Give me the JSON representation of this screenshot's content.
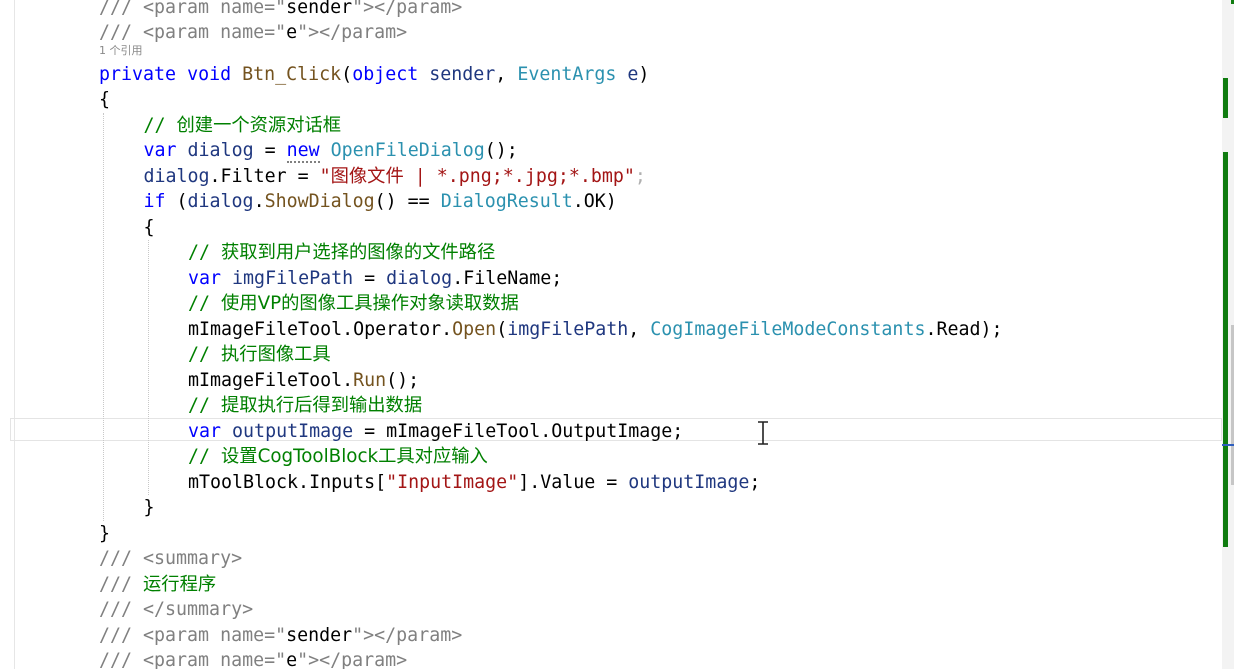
{
  "editor": {
    "lines": [
      {
        "indent": 0,
        "tokens": [
          {
            "t": "/// <param name=\"",
            "c": "doc"
          },
          {
            "t": "sender",
            "c": "plain"
          },
          {
            "t": "\"></param>",
            "c": "doc"
          }
        ]
      },
      {
        "indent": 0,
        "tokens": [
          {
            "t": "/// <param name=\"",
            "c": "doc"
          },
          {
            "t": "e",
            "c": "plain"
          },
          {
            "t": "\"></param>",
            "c": "doc"
          }
        ]
      },
      {
        "indent": 0,
        "tokens": [
          {
            "t": "private",
            "c": "kw"
          },
          {
            "t": " ",
            "c": "plain"
          },
          {
            "t": "void",
            "c": "kw"
          },
          {
            "t": " ",
            "c": "plain"
          },
          {
            "t": "Btn_Click",
            "c": "method"
          },
          {
            "t": "(",
            "c": "plain"
          },
          {
            "t": "object",
            "c": "kw"
          },
          {
            "t": " ",
            "c": "plain"
          },
          {
            "t": "sender",
            "c": "field"
          },
          {
            "t": ", ",
            "c": "plain"
          },
          {
            "t": "EventArgs",
            "c": "type"
          },
          {
            "t": " ",
            "c": "plain"
          },
          {
            "t": "e",
            "c": "field"
          },
          {
            "t": ")",
            "c": "plain"
          }
        ]
      },
      {
        "indent": 0,
        "tokens": [
          {
            "t": "{",
            "c": "plain"
          }
        ]
      },
      {
        "indent": 1,
        "tokens": [
          {
            "t": "// ",
            "c": "com"
          },
          {
            "t": "创建一个资源对话框",
            "c": "com",
            "cjk": true
          }
        ]
      },
      {
        "indent": 1,
        "tokens": [
          {
            "t": "var",
            "c": "kw"
          },
          {
            "t": " ",
            "c": "plain"
          },
          {
            "t": "dialog",
            "c": "field"
          },
          {
            "t": " = ",
            "c": "plain"
          },
          {
            "t": "new",
            "c": "new"
          },
          {
            "t": " ",
            "c": "plain"
          },
          {
            "t": "OpenFileDialog",
            "c": "type"
          },
          {
            "t": "();",
            "c": "plain"
          }
        ]
      },
      {
        "indent": 1,
        "tokens": [
          {
            "t": "dialog",
            "c": "field"
          },
          {
            "t": ".Filter = ",
            "c": "plain"
          },
          {
            "t": "\"",
            "c": "str"
          },
          {
            "t": "图像文件",
            "c": "str",
            "cjk": true
          },
          {
            "t": " | *.png;*.jpg;*.bmp\"",
            "c": "str"
          },
          {
            "t": ";",
            "c": "dim"
          }
        ]
      },
      {
        "indent": 1,
        "tokens": [
          {
            "t": "if",
            "c": "kw"
          },
          {
            "t": " (",
            "c": "plain"
          },
          {
            "t": "dialog",
            "c": "field"
          },
          {
            "t": ".",
            "c": "plain"
          },
          {
            "t": "ShowDialog",
            "c": "method"
          },
          {
            "t": "() == ",
            "c": "plain"
          },
          {
            "t": "DialogResult",
            "c": "type"
          },
          {
            "t": ".OK)",
            "c": "plain"
          }
        ]
      },
      {
        "indent": 1,
        "tokens": [
          {
            "t": "{",
            "c": "plain"
          }
        ]
      },
      {
        "indent": 2,
        "tokens": [
          {
            "t": "// ",
            "c": "com"
          },
          {
            "t": "获取到用户选择的图像的文件路径",
            "c": "com",
            "cjk": true
          }
        ]
      },
      {
        "indent": 2,
        "tokens": [
          {
            "t": "var",
            "c": "kw"
          },
          {
            "t": " ",
            "c": "plain"
          },
          {
            "t": "imgFilePath",
            "c": "field"
          },
          {
            "t": " = ",
            "c": "plain"
          },
          {
            "t": "dialog",
            "c": "field"
          },
          {
            "t": ".FileName;",
            "c": "plain"
          }
        ]
      },
      {
        "indent": 2,
        "tokens": [
          {
            "t": "// ",
            "c": "com"
          },
          {
            "t": "使用VP的图像工具操作对象读取数据",
            "c": "com",
            "cjk": true
          }
        ]
      },
      {
        "indent": 2,
        "tokens": [
          {
            "t": "mImageFileTool.Operator.",
            "c": "plain"
          },
          {
            "t": "Open",
            "c": "method"
          },
          {
            "t": "(",
            "c": "plain"
          },
          {
            "t": "imgFilePath",
            "c": "field"
          },
          {
            "t": ", ",
            "c": "plain"
          },
          {
            "t": "CogImageFileModeConstants",
            "c": "type"
          },
          {
            "t": ".Read);",
            "c": "plain"
          }
        ]
      },
      {
        "indent": 2,
        "tokens": [
          {
            "t": "// ",
            "c": "com"
          },
          {
            "t": "执行图像工具",
            "c": "com",
            "cjk": true
          }
        ]
      },
      {
        "indent": 2,
        "tokens": [
          {
            "t": "mImageFileTool.",
            "c": "plain"
          },
          {
            "t": "Run",
            "c": "method"
          },
          {
            "t": "();",
            "c": "plain"
          }
        ]
      },
      {
        "indent": 2,
        "tokens": [
          {
            "t": "// ",
            "c": "com"
          },
          {
            "t": "提取执行后得到输出数据",
            "c": "com",
            "cjk": true
          }
        ]
      },
      {
        "indent": 2,
        "tokens": [
          {
            "t": "var",
            "c": "kw"
          },
          {
            "t": " ",
            "c": "plain"
          },
          {
            "t": "outputImage",
            "c": "field"
          },
          {
            "t": " = mImageFileTool.OutputImage;",
            "c": "plain"
          }
        ]
      },
      {
        "indent": 2,
        "tokens": [
          {
            "t": "// ",
            "c": "com"
          },
          {
            "t": "设置CogToolBlock工具对应输入",
            "c": "com",
            "cjk": true
          }
        ]
      },
      {
        "indent": 2,
        "tokens": [
          {
            "t": "mToolBlock.Inputs[",
            "c": "plain"
          },
          {
            "t": "\"InputImage\"",
            "c": "str"
          },
          {
            "t": "].Value = ",
            "c": "plain"
          },
          {
            "t": "outputImage",
            "c": "field"
          },
          {
            "t": ";",
            "c": "plain"
          }
        ]
      },
      {
        "indent": 1,
        "tokens": [
          {
            "t": "}",
            "c": "plain"
          }
        ]
      },
      {
        "indent": 0,
        "tokens": [
          {
            "t": "}",
            "c": "plain"
          }
        ]
      },
      {
        "indent": 0,
        "tokens": [
          {
            "t": "/// <summary>",
            "c": "doc"
          }
        ]
      },
      {
        "indent": 0,
        "tokens": [
          {
            "t": "/// ",
            "c": "doc"
          },
          {
            "t": "运行程序",
            "c": "com",
            "cjk": true
          }
        ]
      },
      {
        "indent": 0,
        "tokens": [
          {
            "t": "/// </summary>",
            "c": "doc"
          }
        ]
      },
      {
        "indent": 0,
        "tokens": [
          {
            "t": "/// <param name=\"",
            "c": "doc"
          },
          {
            "t": "sender",
            "c": "plain"
          },
          {
            "t": "\"></param>",
            "c": "doc"
          }
        ]
      },
      {
        "indent": 0,
        "tokens": [
          {
            "t": "/// <param name=\"",
            "c": "doc"
          },
          {
            "t": "e",
            "c": "plain"
          },
          {
            "t": "\"></param>",
            "c": "doc"
          }
        ]
      }
    ],
    "codelens": [
      {
        "after_line": 1,
        "text": "1 个引用"
      }
    ],
    "current_line": 16
  },
  "icons": {
    "text_cursor": "i-beam-cursor-icon"
  },
  "colors": {
    "keyword": "#0000ff",
    "type": "#2b91af",
    "string": "#a31515",
    "comment": "#008000",
    "doc": "#808080",
    "method": "#74531f",
    "field": "#1f377f",
    "change_marker": "#107c10"
  }
}
